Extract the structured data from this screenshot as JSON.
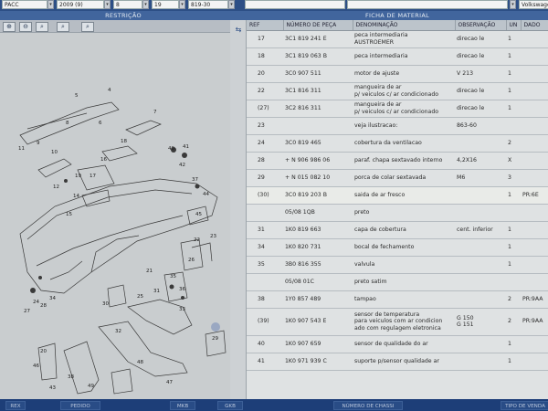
{
  "topbar": {
    "fields": [
      "PACC",
      "2009 (9)",
      "8",
      "19",
      "819-30",
      "",
      "",
      "Volkswagen"
    ],
    "colors": {
      "bar": "#2d4f86"
    }
  },
  "sections": {
    "left_title": "RESTRIÇÃO",
    "right_title": "FICHA DE MATERIAL"
  },
  "zoom_tools": [
    "zoom-in-icon",
    "zoom-out-icon",
    "zoom-fit-icon",
    "zoom-area-icon",
    "zoom-reset-icon"
  ],
  "diagram": {
    "callouts": [
      "4",
      "5",
      "6",
      "7",
      "8",
      "9",
      "10",
      "11",
      "12",
      "14",
      "15",
      "16",
      "17",
      "18",
      "19",
      "20",
      "21",
      "22",
      "23",
      "24",
      "25",
      "26",
      "27",
      "28",
      "29",
      "30",
      "31",
      "32",
      "33",
      "34",
      "35",
      "36",
      "37",
      "38",
      "40",
      "41",
      "42",
      "43",
      "44",
      "45",
      "46",
      "47",
      "48",
      "49"
    ]
  },
  "nav": {
    "icon": "expand-arrows-icon"
  },
  "table": {
    "headers": [
      "REF",
      "NÚMERO DE PEÇA",
      "DENOMINAÇÃO",
      "OBSERVAÇÃO",
      "UN",
      "DADO"
    ],
    "rows": [
      {
        "ref": "17",
        "part": "3C1  819  241  E",
        "name": "peca intermediaria\nAUSTROEMER",
        "obs": "direcao     le",
        "un": "1",
        "dado": ""
      },
      {
        "ref": "18",
        "part": "3C1  819  063  B",
        "name": "peca intermediaria",
        "obs": "direcao     le",
        "un": "1",
        "dado": ""
      },
      {
        "ref": "20",
        "part": "3C0  907  511",
        "name": "motor de ajuste",
        "obs": "V 213",
        "un": "1",
        "dado": ""
      },
      {
        "ref": "22",
        "part": "3C1  816  311",
        "name": "mangueira de ar\np/ veiculos c/ ar condicionado",
        "obs": "direcao     le",
        "un": "1",
        "dado": ""
      },
      {
        "ref": "(27)",
        "part": "3C2  816  311",
        "name": "mangueira de ar\np/ veiculos c/ ar condicionado",
        "obs": "direcao     le",
        "un": "1",
        "dado": ""
      },
      {
        "ref": "23",
        "part": "",
        "name": "veja ilustracao:",
        "obs": "863-60",
        "un": "",
        "dado": ""
      },
      {
        "ref": "24",
        "part": "3C0  819  465",
        "name": "cobertura da ventilacao",
        "obs": "",
        "un": "2",
        "dado": ""
      },
      {
        "ref": "28",
        "part": "+  N    906  986  06",
        "name": "paraf. chapa sextavado interno",
        "obs": "4,2X16",
        "un": "X",
        "dado": ""
      },
      {
        "ref": "29",
        "part": "+  N    015  082  10",
        "name": "porca de colar sextavada",
        "obs": "M6",
        "un": "3",
        "dado": ""
      },
      {
        "ref": "(30)",
        "part": "3C0  819  203  B",
        "name": "saida de ar fresco",
        "obs": "",
        "un": "1",
        "dado": "PR:6E"
      },
      {
        "ref": "",
        "part": "05/08          1QB",
        "name": "preto",
        "obs": "",
        "un": "",
        "dado": ""
      },
      {
        "ref": "31",
        "part": "1K0  819  663",
        "name": "capa de cobertura",
        "obs": "cent. inferior",
        "un": "1",
        "dado": ""
      },
      {
        "ref": "34",
        "part": "1K0  820  731",
        "name": "bocal de fechamento",
        "obs": "",
        "un": "1",
        "dado": ""
      },
      {
        "ref": "35",
        "part": "3B0  816  355",
        "name": "valvula",
        "obs": "",
        "un": "1",
        "dado": ""
      },
      {
        "ref": "",
        "part": "05/08          01C",
        "name": "preto satim",
        "obs": "",
        "un": "",
        "dado": ""
      },
      {
        "ref": "38",
        "part": "1Y0  857  489",
        "name": "tampao",
        "obs": "",
        "un": "2",
        "dado": "PR:9AA"
      },
      {
        "ref": "(39)",
        "part": "1K0  907  543  E",
        "name": "sensor de temperatura\npara veiculos com ar condicion\nado com regulagem eletronica",
        "obs": "G 150\nG 151",
        "un": "2",
        "dado": "PR:9AA"
      },
      {
        "ref": "40",
        "part": "1K0  907  659",
        "name": "sensor de qualidade do ar",
        "obs": "",
        "un": "1",
        "dado": ""
      },
      {
        "ref": "41",
        "part": "1K0  971  939  C",
        "name": "suporte p/sensor qualidade ar",
        "obs": "",
        "un": "1",
        "dado": ""
      }
    ]
  },
  "bottombar": [
    "REX",
    "PEDIDO",
    "MKB",
    "GKB",
    "NÚMERO DE CHASSI",
    "TIPO DE VENDA"
  ]
}
